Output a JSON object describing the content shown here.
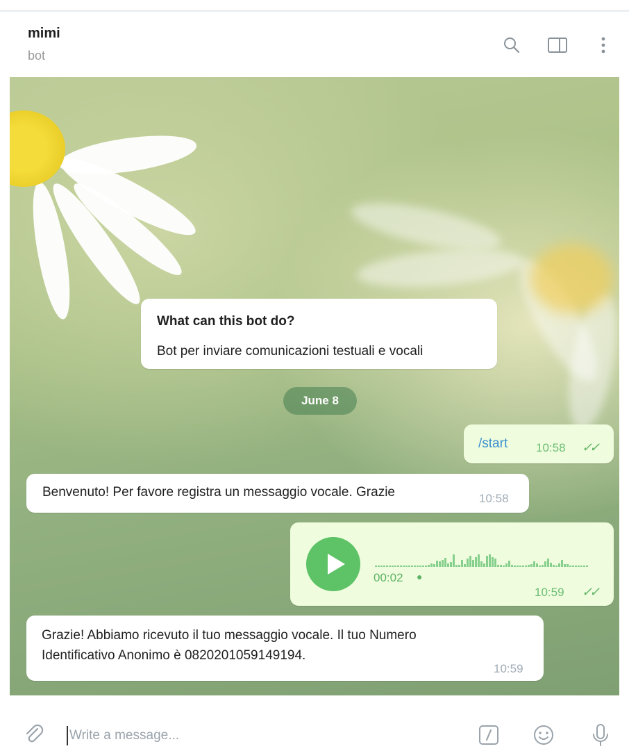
{
  "header": {
    "title": "mimi",
    "subtitle": "bot"
  },
  "intro": {
    "heading": "What can this bot do?",
    "body": "Bot per inviare comunicazioni testuali e vocali"
  },
  "date_separator": "June 8",
  "messages": [
    {
      "direction": "out",
      "text": "/start",
      "time": "10:58",
      "read": true
    },
    {
      "direction": "in",
      "text": "Benvenuto! Per favore registra un messaggio vocale. Grazie",
      "time": "10:58"
    },
    {
      "direction": "out",
      "type": "voice",
      "duration": "00:02",
      "status_dot": "●",
      "time": "10:59",
      "read": true
    },
    {
      "direction": "in",
      "line1": "Grazie! Abbiamo ricevuto il tuo messaggio vocale. Il tuo Numero",
      "line2": "Identificativo Anonimo è 0820201059149194.",
      "time": "10:59"
    }
  ],
  "composer": {
    "placeholder": "Write a message..."
  },
  "icons": {
    "search": "search-icon",
    "sidebar": "sidebar-toggle-icon",
    "more": "more-vertical-icon",
    "attach": "paperclip-icon",
    "commands": "slash-command-icon",
    "emoji": "emoji-icon",
    "mic": "microphone-icon",
    "check": "✓✓"
  },
  "colors": {
    "outgoing_bubble": "#effdde",
    "incoming_bubble": "#ffffff",
    "accent_green": "#5ec267",
    "read_check": "#5fb365"
  }
}
